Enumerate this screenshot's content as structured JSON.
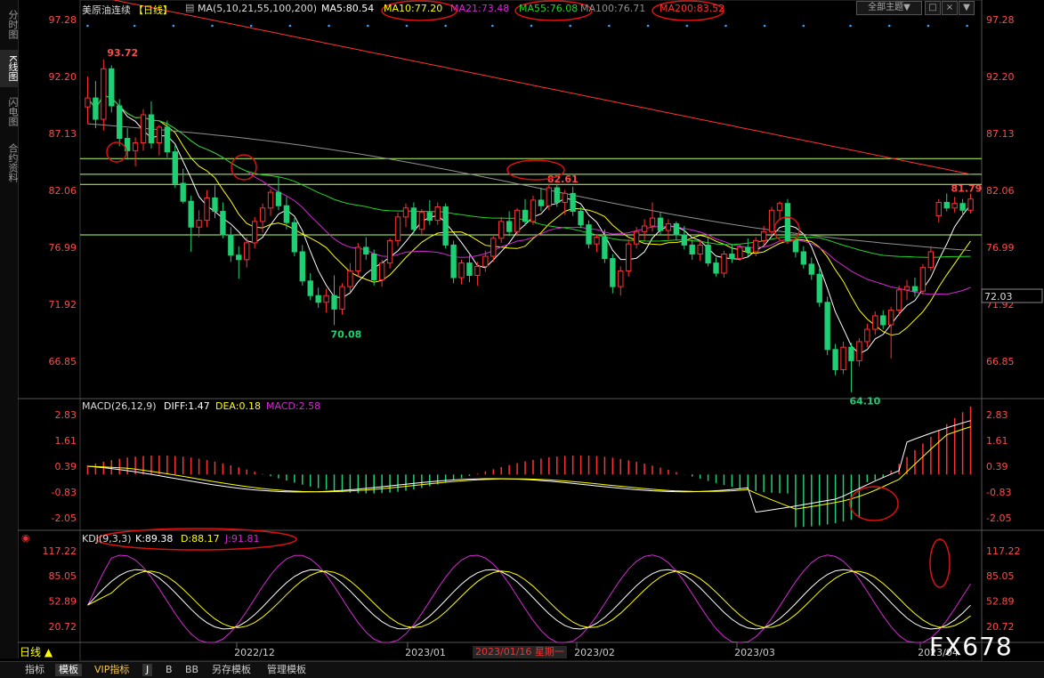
{
  "app": {
    "period_label": "日线 ▲",
    "watermark": "FX678",
    "theme": "全部主题▼",
    "win_controls": [
      "□",
      "×",
      "▼"
    ]
  },
  "left_rail": {
    "tabs": [
      "分时图",
      "K线图",
      "闪电图",
      "合约资料"
    ],
    "active": 1
  },
  "bottom_bar": {
    "tabs": [
      "指标",
      "模板",
      "VIP指标",
      "J",
      "B",
      "BB",
      "另存模板",
      "管理模板"
    ],
    "active": 1
  },
  "colors": {
    "up": "#ff3232",
    "down": "#1ecf73",
    "ma5": "#ffffff",
    "ma10": "#ffff00",
    "ma21": "#d627d6",
    "ma55": "#22d822",
    "ma100": "#909090",
    "ma200": "#ff3232",
    "dea": "#ffff00"
  },
  "header": {
    "symbol": "美原油连续",
    "period": "【日线】",
    "ma_params": "MA(5,10,21,55,100,200)",
    "ma5": "MA5:80.54",
    "ma10": "MA10:77.20",
    "ma21": "MA21:73.48",
    "ma55": "MA55:76.08",
    "ma100": "MA100:76.71",
    "ma200": "MA200:83.52"
  },
  "macd_header": {
    "name": "MACD(26,12,9)",
    "diff": "DIFF:1.47",
    "dea": "DEA:0.18",
    "macd": "MACD:2.58"
  },
  "kdj_header": {
    "name": "KDJ(9,3,3)",
    "k": "K:89.38",
    "d": "D:88.17",
    "j": "J:91.81"
  },
  "price_axis_labels": [
    "97.28",
    "92.20",
    "87.13",
    "82.06",
    "76.99",
    "71.92",
    "66.85"
  ],
  "price_marker": "72.03",
  "macd_axis_labels": [
    "2.83",
    "1.61",
    "0.39",
    "-0.83",
    "-2.05"
  ],
  "kdj_axis_labels": [
    "117.22",
    "85.05",
    "52.89",
    "20.72"
  ],
  "date_labels": [
    "2022/12",
    "2023/01",
    "2023/02",
    "2023/03",
    "2023/04"
  ],
  "date_highlight": "2023/01/16 星期一",
  "annotations": {
    "high": "93.72",
    "low1": "70.08",
    "peak": "82.61",
    "low2": "64.10",
    "last": "81.79"
  },
  "chart_data": {
    "type": "candlestick",
    "symbol": "美原油连续",
    "period": "日线",
    "price_range": [
      64,
      97.28
    ],
    "candles": [
      [
        89.5,
        92.2,
        88.0,
        90.3
      ],
      [
        90.3,
        91.8,
        87.6,
        88.4
      ],
      [
        88.4,
        93.72,
        87.4,
        92.9
      ],
      [
        92.9,
        93.2,
        89.0,
        89.6
      ],
      [
        89.6,
        90.2,
        86.0,
        86.7
      ],
      [
        86.7,
        87.6,
        84.8,
        85.6
      ],
      [
        85.6,
        86.8,
        84.2,
        86.3
      ],
      [
        86.3,
        89.3,
        85.6,
        88.8
      ],
      [
        88.8,
        90.0,
        85.8,
        86.3
      ],
      [
        86.3,
        87.9,
        85.2,
        87.7
      ],
      [
        87.7,
        88.3,
        85.0,
        85.5
      ],
      [
        85.5,
        86.1,
        82.3,
        82.7
      ],
      [
        82.7,
        84.0,
        80.9,
        81.1
      ],
      [
        81.1,
        81.6,
        76.6,
        78.8
      ],
      [
        78.8,
        80.3,
        77.9,
        79.4
      ],
      [
        79.4,
        82.1,
        78.8,
        81.4
      ],
      [
        81.4,
        82.5,
        79.6,
        80.2
      ],
      [
        80.2,
        81.0,
        77.8,
        78.1
      ],
      [
        78.1,
        78.8,
        75.7,
        76.3
      ],
      [
        76.3,
        77.1,
        74.2,
        75.9
      ],
      [
        75.9,
        77.9,
        75.2,
        77.4
      ],
      [
        77.4,
        79.7,
        76.9,
        79.3
      ],
      [
        79.3,
        80.9,
        78.3,
        80.5
      ],
      [
        80.5,
        82.2,
        79.8,
        81.9
      ],
      [
        81.9,
        83.3,
        80.3,
        80.7
      ],
      [
        80.7,
        81.5,
        78.6,
        79.2
      ],
      [
        79.2,
        79.6,
        76.2,
        76.6
      ],
      [
        76.6,
        77.2,
        73.6,
        74.0
      ],
      [
        74.0,
        74.7,
        72.3,
        72.7
      ],
      [
        72.7,
        73.4,
        71.6,
        72.1
      ],
      [
        72.1,
        73.3,
        71.2,
        72.7
      ],
      [
        72.7,
        74.5,
        70.08,
        71.5
      ],
      [
        71.5,
        73.8,
        71.0,
        73.5
      ],
      [
        73.5,
        75.6,
        73.0,
        74.9
      ],
      [
        74.9,
        77.4,
        74.4,
        77.0
      ],
      [
        77.0,
        77.9,
        75.9,
        76.4
      ],
      [
        76.4,
        76.8,
        73.6,
        74.1
      ],
      [
        74.1,
        75.9,
        73.5,
        75.6
      ],
      [
        75.6,
        77.8,
        75.1,
        77.6
      ],
      [
        77.6,
        80.1,
        77.1,
        79.7
      ],
      [
        79.7,
        80.9,
        78.8,
        80.5
      ],
      [
        80.5,
        81.0,
        78.2,
        78.6
      ],
      [
        78.6,
        80.4,
        78.0,
        80.1
      ],
      [
        80.1,
        81.2,
        79.0,
        79.4
      ],
      [
        79.4,
        81.0,
        79.0,
        80.6
      ],
      [
        80.6,
        80.9,
        76.9,
        77.2
      ],
      [
        77.2,
        77.6,
        73.8,
        74.3
      ],
      [
        74.3,
        75.9,
        73.7,
        75.6
      ],
      [
        75.6,
        76.3,
        73.9,
        74.5
      ],
      [
        74.5,
        75.7,
        73.6,
        75.3
      ],
      [
        75.3,
        76.7,
        74.8,
        76.2
      ],
      [
        76.2,
        78.0,
        75.7,
        77.8
      ],
      [
        77.8,
        79.7,
        77.4,
        79.3
      ],
      [
        79.3,
        80.2,
        78.0,
        78.4
      ],
      [
        78.4,
        80.5,
        78.0,
        80.3
      ],
      [
        80.3,
        81.3,
        78.9,
        79.3
      ],
      [
        79.3,
        81.6,
        79.0,
        81.2
      ],
      [
        81.2,
        82.3,
        80.2,
        80.7
      ],
      [
        80.7,
        82.61,
        80.3,
        82.3
      ],
      [
        82.3,
        82.6,
        80.6,
        81.0
      ],
      [
        81.0,
        82.1,
        79.9,
        81.8
      ],
      [
        81.8,
        82.4,
        79.8,
        80.2
      ],
      [
        80.2,
        80.6,
        78.7,
        79.0
      ],
      [
        79.0,
        79.4,
        76.9,
        77.3
      ],
      [
        77.3,
        78.2,
        76.6,
        77.9
      ],
      [
        77.9,
        78.6,
        75.6,
        76.0
      ],
      [
        76.0,
        76.4,
        72.9,
        73.5
      ],
      [
        73.5,
        75.3,
        72.7,
        74.9
      ],
      [
        74.9,
        77.7,
        74.4,
        77.3
      ],
      [
        77.3,
        78.8,
        76.9,
        78.4
      ],
      [
        78.4,
        79.5,
        77.6,
        78.9
      ],
      [
        78.9,
        81.0,
        78.4,
        79.6
      ],
      [
        79.6,
        80.1,
        78.1,
        78.5
      ],
      [
        78.5,
        79.5,
        77.7,
        79.1
      ],
      [
        79.1,
        79.3,
        77.6,
        78.1
      ],
      [
        78.1,
        78.9,
        76.8,
        77.2
      ],
      [
        77.2,
        77.7,
        75.9,
        76.4
      ],
      [
        76.4,
        77.6,
        75.8,
        77.2
      ],
      [
        77.2,
        77.9,
        75.3,
        75.6
      ],
      [
        75.6,
        76.1,
        74.4,
        74.7
      ],
      [
        74.7,
        76.7,
        74.3,
        76.4
      ],
      [
        76.4,
        77.3,
        75.6,
        76.0
      ],
      [
        76.0,
        77.3,
        75.8,
        77.0
      ],
      [
        77.0,
        77.8,
        76.2,
        76.6
      ],
      [
        76.6,
        77.9,
        76.2,
        77.6
      ],
      [
        77.6,
        78.9,
        77.1,
        78.4
      ],
      [
        78.4,
        80.6,
        78.0,
        80.3
      ],
      [
        80.3,
        81.1,
        79.4,
        80.9
      ],
      [
        80.9,
        81.3,
        77.3,
        77.6
      ],
      [
        77.6,
        77.9,
        76.1,
        76.6
      ],
      [
        76.6,
        77.1,
        75.1,
        75.5
      ],
      [
        75.5,
        76.1,
        74.1,
        74.6
      ],
      [
        74.6,
        75.1,
        71.7,
        72.1
      ],
      [
        72.1,
        72.6,
        67.4,
        67.9
      ],
      [
        67.9,
        68.4,
        65.6,
        66.1
      ],
      [
        66.1,
        68.6,
        65.7,
        68.1
      ],
      [
        68.1,
        68.5,
        64.1,
        66.9
      ],
      [
        66.9,
        68.9,
        66.4,
        68.6
      ],
      [
        68.6,
        70.2,
        68.1,
        69.7
      ],
      [
        69.7,
        71.3,
        69.2,
        70.9
      ],
      [
        70.9,
        71.4,
        69.7,
        70.1
      ],
      [
        70.1,
        71.7,
        67.1,
        71.4
      ],
      [
        71.4,
        73.6,
        70.9,
        73.2
      ],
      [
        73.2,
        74.1,
        72.3,
        73.5
      ],
      [
        73.5,
        74.3,
        72.6,
        73.1
      ],
      [
        73.1,
        75.5,
        72.8,
        75.2
      ],
      [
        75.2,
        77.1,
        74.9,
        76.6
      ],
      [
        79.8,
        81.3,
        79.2,
        81.0
      ],
      [
        81.0,
        81.8,
        80.2,
        80.5
      ],
      [
        80.5,
        81.5,
        80.1,
        80.9
      ],
      [
        80.9,
        81.3,
        79.8,
        80.3
      ],
      [
        80.3,
        81.79,
        80.0,
        81.3
      ]
    ],
    "macd_range": [
      -2.6,
      2.83
    ],
    "kdj_range": [
      0,
      125
    ]
  }
}
